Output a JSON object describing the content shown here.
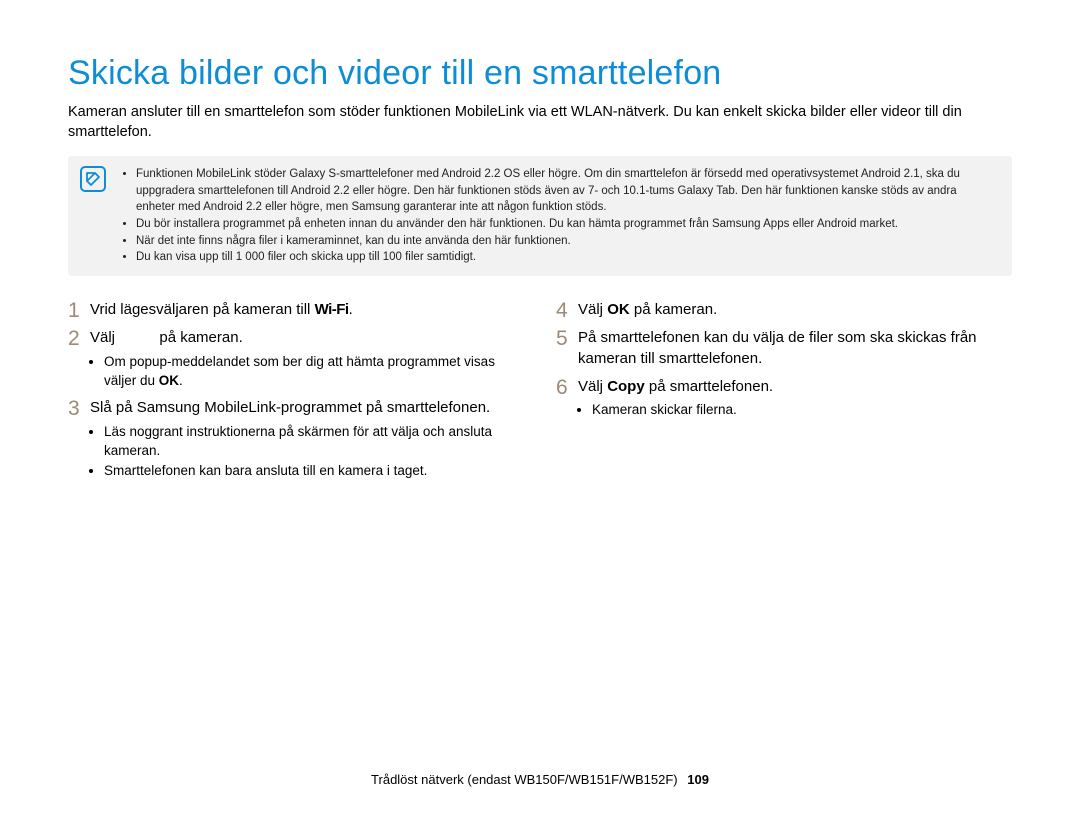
{
  "title": "Skicka bilder och videor till en smarttelefon",
  "intro": "Kameran ansluter till en smarttelefon som stöder funktionen MobileLink via ett WLAN-nätverk. Du kan enkelt skicka bilder eller videor till din smarttelefon.",
  "notes": {
    "items": [
      "Funktionen MobileLink stöder Galaxy S-smarttelefoner med Android 2.2 OS eller högre. Om din smarttelefon är försedd med operativsystemet Android 2.1, ska du uppgradera smarttelefonen till Android 2.2 eller högre. Den här funktionen stöds även av 7- och 10.1-tums Galaxy Tab. Den här funktionen kanske stöds av andra enheter med Android 2.2 eller högre, men Samsung garanterar inte att någon funktion stöds.",
      "Du bör installera programmet på enheten innan du använder den här funktionen. Du kan hämta programmet från Samsung Apps eller Android market.",
      "När det inte finns några filer i kameraminnet, kan du inte använda den här funktionen.",
      "Du kan visa upp till 1 000 filer och skicka upp till 100 filer samtidigt."
    ]
  },
  "steps": {
    "left": [
      {
        "num": "1",
        "pre": "Vrid lägesväljaren på kameran till ",
        "wifi": "Wi-Fi",
        "post": "."
      },
      {
        "num": "2",
        "pre": "Välj ",
        "blank": true,
        "post": " på kameran.",
        "bullets": [
          {
            "pre": "Om popup-meddelandet som ber dig att hämta programmet visas väljer du ",
            "bold": "OK",
            "post": "."
          }
        ]
      },
      {
        "num": "3",
        "text": "Slå på Samsung MobileLink-programmet på smarttelefonen.",
        "bullets": [
          {
            "text": "Läs noggrant instruktionerna på skärmen för att välja och ansluta kameran."
          },
          {
            "text": "Smarttelefonen kan bara ansluta till en kamera i taget."
          }
        ]
      }
    ],
    "right": [
      {
        "num": "4",
        "pre": "Välj ",
        "bold": "OK",
        "post": " på kameran."
      },
      {
        "num": "5",
        "text": "På smarttelefonen kan du välja de filer som ska skickas från kameran till smarttelefonen."
      },
      {
        "num": "6",
        "pre": "Välj ",
        "bold": "Copy",
        "post": " på smarttelefonen.",
        "bullets": [
          {
            "text": "Kameran skickar filerna."
          }
        ]
      }
    ]
  },
  "footer": {
    "text": "Trådlöst nätverk (endast WB150F/WB151F/WB152F)",
    "page": "109"
  }
}
